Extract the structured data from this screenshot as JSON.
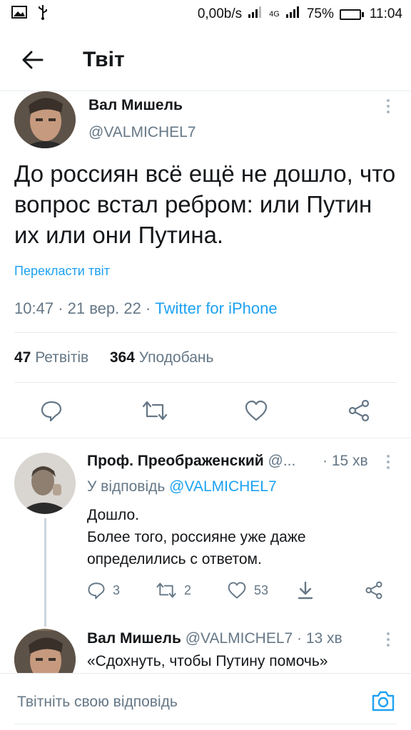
{
  "status_bar": {
    "net_speed": "0,00b/s",
    "network": "4G",
    "battery": "75%",
    "battery_level": 0.75,
    "time": "11:04",
    "icons": [
      "image-icon",
      "usb-icon",
      "signal-icon",
      "battery-icon"
    ]
  },
  "header": {
    "title": "Твіт",
    "back_icon": "arrow-left-icon"
  },
  "main_tweet": {
    "author_name": "Вал Мишель",
    "author_handle": "@VALMICHEL7",
    "text": "До россиян всё ещё не дошло, что вопрос встал ребром: или Путин их или они Путина.",
    "translate_label": "Перекласти твіт",
    "time": "10:47",
    "date": "21 вер. 22",
    "client": "Twitter for iPhone",
    "retweets_count": "47",
    "retweets_label": "Ретвітів",
    "likes_count": "364",
    "likes_label": "Уподобань",
    "actions": [
      "reply-icon",
      "retweet-icon",
      "like-icon",
      "share-icon"
    ]
  },
  "reply": {
    "author_name": "Проф. Преображенский",
    "author_handle": "@...",
    "time": "· 15 хв",
    "reply_to_label": "У відповідь",
    "reply_to_handle": "@VALMICHEL7",
    "text_line1": "Дошло.",
    "text_line2": "Более того, россияне уже даже определились с ответом.",
    "reply_count": "3",
    "retweet_count": "2",
    "like_count": "53"
  },
  "reply2": {
    "author_name": "Вал Мишель",
    "author_handle": "@VALMICHEL7",
    "time": "· 13 хв",
    "text": "«Сдохнуть, чтобы Путину помочь»"
  },
  "compose": {
    "placeholder": "Твітніть свою відповідь",
    "camera_icon": "camera-icon"
  },
  "colors": {
    "accent": "#1da1f2",
    "text": "#14171a",
    "secondary": "#657786",
    "battery": "#3fbf3f"
  }
}
